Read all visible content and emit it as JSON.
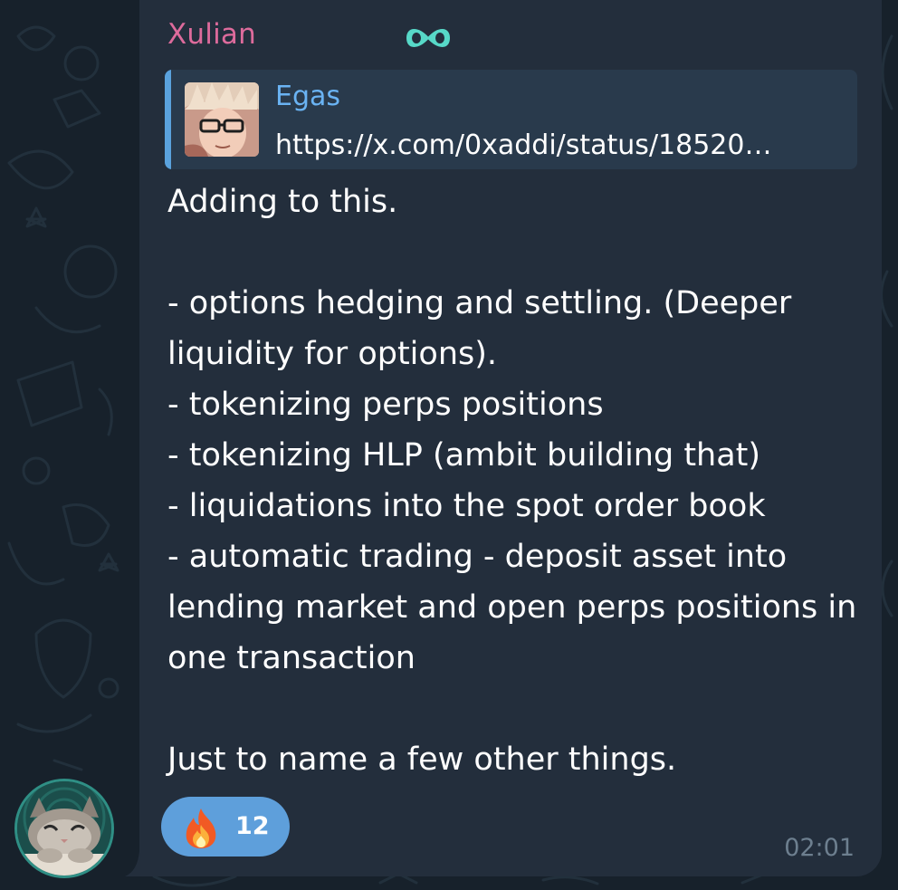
{
  "colors": {
    "background": "#17212b",
    "bubble": "#232e3c",
    "sender_name": "#dd6b9c",
    "reply_accent": "#5aa2dd",
    "reply_author": "#6ab3f3",
    "reaction_pill": "#5e9fdb",
    "timestamp": "#6d7f8f"
  },
  "message": {
    "sender": "Xulian",
    "sender_badge_icon": "infinity-badge-icon",
    "reply": {
      "author": "Egas",
      "text": "https://x.com/0xaddi/status/18520…",
      "thumbnail_icon": "reply-author-avatar"
    },
    "body": "Adding to this.\n\n- options hedging and settling. (Deeper liquidity for options).\n- tokenizing perps positions\n- tokenizing HLP (ambit building that)\n- liquidations into the spot order book\n- automatic trading - deposit asset into lending market and open perps positions in one transaction\n\nJust to name a few other things.",
    "reaction": {
      "emoji_icon": "fire-emoji-icon",
      "count": "12"
    },
    "time": "02:01",
    "avatar_icon": "cat-avatar"
  }
}
